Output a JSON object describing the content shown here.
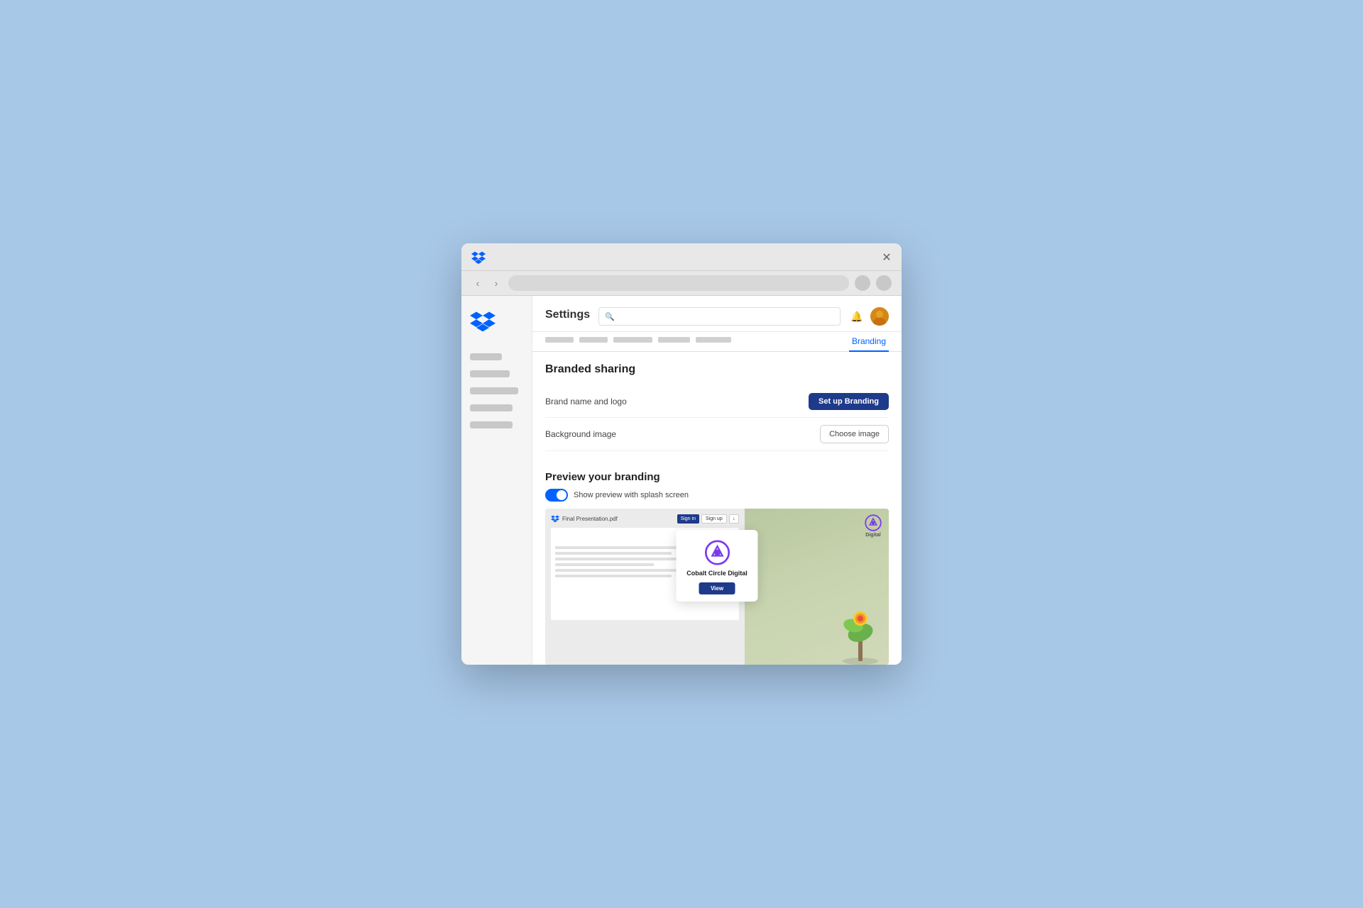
{
  "browser": {
    "close_label": "✕",
    "back_arrow": "‹",
    "forward_arrow": "›"
  },
  "sidebar": {
    "items": [
      {
        "label": "",
        "width": "60"
      },
      {
        "label": "",
        "width": "75"
      },
      {
        "label": "",
        "width": "90"
      },
      {
        "label": "",
        "width": "80"
      },
      {
        "label": "",
        "width": "80"
      }
    ]
  },
  "header": {
    "title": "Settings",
    "search_placeholder": "",
    "tab_active": "Branding",
    "tabs_placeholder": [
      "",
      "",
      "",
      "",
      ""
    ]
  },
  "branding": {
    "section_title": "Branded sharing",
    "brand_field_label": "Brand name and logo",
    "setup_btn_label": "Set up Branding",
    "bg_field_label": "Background image",
    "choose_image_label": "Choose image",
    "preview_title": "Preview your branding",
    "toggle_label": "Show preview with splash screen"
  },
  "preview": {
    "filename": "Final Presentation.pdf",
    "signin_label": "Sign in",
    "signup_label": "Sign up",
    "brand_name": "Cobalt Circle Digital",
    "view_label": "View"
  },
  "colors": {
    "primary": "#1e3a8a",
    "accent": "#0061ff",
    "toggle_on": "#0061ff",
    "brand_purple": "#7c3aed"
  }
}
